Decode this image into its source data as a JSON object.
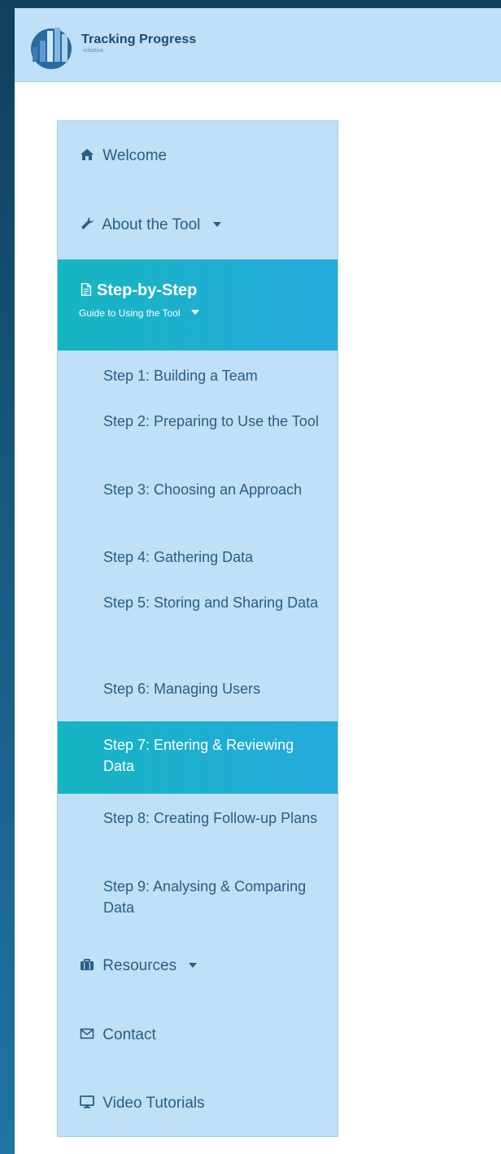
{
  "brand": {
    "title": "Tracking Progress",
    "subtitle": "initiative"
  },
  "sidebar": {
    "welcome": "Welcome",
    "about": "About the Tool",
    "guide": {
      "title": "Step-by-Step",
      "subtitle": "Guide to Using the Tool"
    },
    "steps": [
      "Step 1: Building a Team",
      "Step 2: Preparing to Use the Tool",
      "Step 3: Choosing an Approach",
      "Step 4: Gathering Data",
      "Step 5: Storing and Sharing Data",
      "Step 6: Managing Users",
      "Step 7: Entering & Reviewing Data",
      "Step 8: Creating Follow-up Plans",
      "Step 9: Analysing & Comparing Data"
    ],
    "resources": "Resources",
    "contact": "Contact",
    "video": "Video Tutorials"
  },
  "colors": {
    "accent": "#16b5c2",
    "sidebar_bg": "#bfe0f7",
    "text": "#2c5d84"
  }
}
